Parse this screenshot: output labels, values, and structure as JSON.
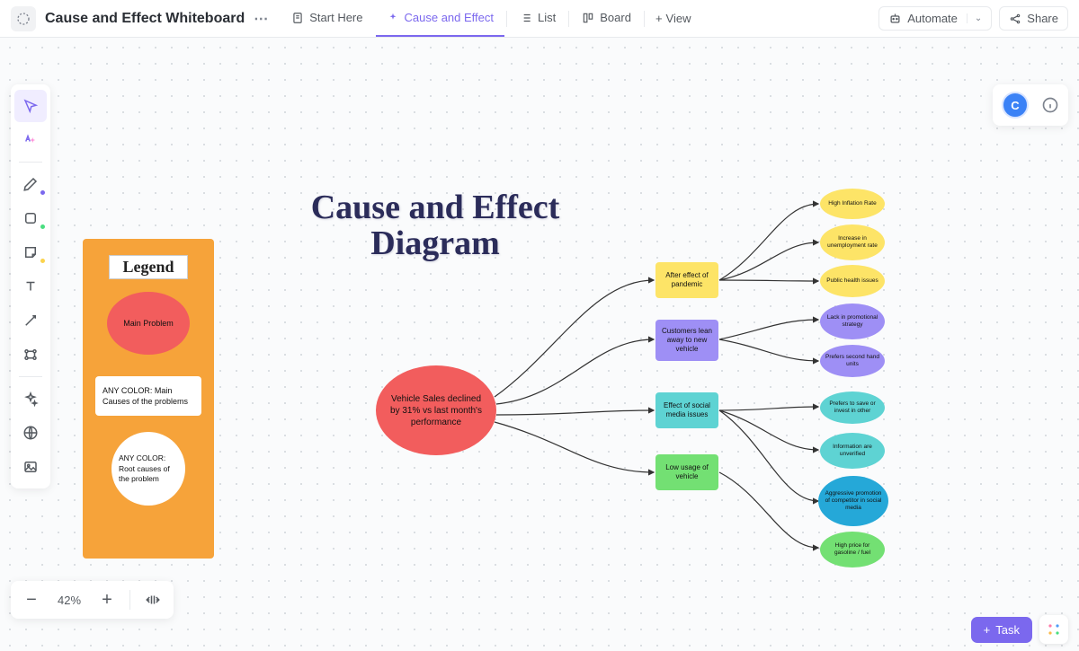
{
  "header": {
    "doc_title": "Cause and Effect Whiteboard",
    "tabs": [
      {
        "icon": "doc",
        "label": "Start Here"
      },
      {
        "icon": "sparkle",
        "label": "Cause and Effect",
        "active": true
      },
      {
        "icon": "list",
        "label": "List"
      },
      {
        "icon": "board",
        "label": "Board"
      }
    ],
    "view_label": "View",
    "automate_label": "Automate",
    "share_label": "Share"
  },
  "presence": {
    "avatar_initial": "C"
  },
  "zoom": {
    "percent": "42%"
  },
  "task_btn": "Task",
  "whiteboard": {
    "title": "Cause and Effect Diagram",
    "legend": {
      "title": "Legend",
      "main_problem": "Main Problem",
      "main_causes": "ANY COLOR: Main Causes of the problems",
      "root_causes": "ANY COLOR: Root causes of the problem"
    },
    "main_node": "Vehicle Sales declined by 31% vs last month's performance",
    "causes": [
      {
        "color": "yellow",
        "label": "After effect of pandemic"
      },
      {
        "color": "purple",
        "label": "Customers lean away to new vehicle"
      },
      {
        "color": "teal",
        "label": "Effect of social media issues"
      },
      {
        "color": "green",
        "label": "Low usage of vehicle"
      }
    ],
    "roots": [
      {
        "color": "yellow",
        "label": "High Inflation Rate"
      },
      {
        "color": "yellow",
        "label": "Increase in unemployment rate"
      },
      {
        "color": "yellow",
        "label": "Public health issues"
      },
      {
        "color": "purple",
        "label": "Lack in promotional strategy"
      },
      {
        "color": "purple",
        "label": "Prefers second hand units"
      },
      {
        "color": "teal",
        "label": "Prefers to save or invest in other"
      },
      {
        "color": "teal",
        "label": "Information are unverified"
      },
      {
        "color": "bigteal",
        "label": "Aggressive promotion of competitor in social media"
      },
      {
        "color": "green",
        "label": "High price for gasoline / fuel"
      }
    ]
  }
}
